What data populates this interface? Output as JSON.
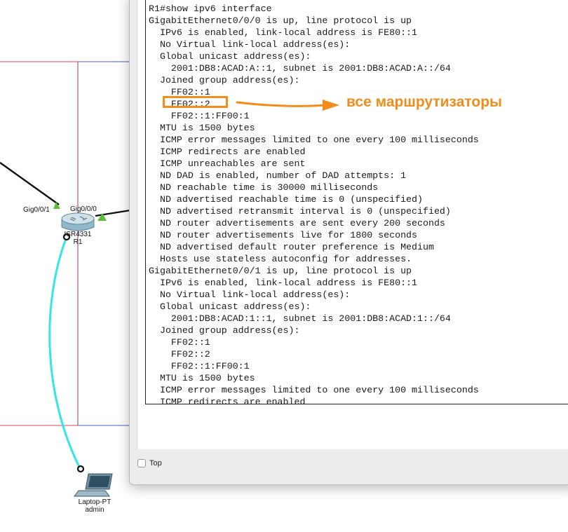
{
  "topology": {
    "interface_left_label": "Gig0/0/1",
    "interface_right_label": "Gig0/0/0",
    "router_model": "ISR4331",
    "router_name": "R1",
    "laptop_model": "Laptop-PT",
    "laptop_name": "admin",
    "icons": [
      "router-icon",
      "laptop-icon"
    ],
    "colors": {
      "console_cable": "#35e6e6",
      "link": "#111111",
      "area_red": "#d9465a",
      "area_blue": "#3b63c4",
      "area_purple": "#8c3a78",
      "link_up": "#5cbf3a"
    }
  },
  "cli": {
    "lines": [
      "R1#show ipv6 interface",
      "GigabitEthernet0/0/0 is up, line protocol is up",
      "  IPv6 is enabled, link-local address is FE80::1",
      "  No Virtual link-local address(es):",
      "  Global unicast address(es):",
      "    2001:DB8:ACAD:A::1, subnet is 2001:DB8:ACAD:A::/64",
      "  Joined group address(es):",
      "    FF02::1",
      "    FF02::2",
      "    FF02::1:FF00:1",
      "  MTU is 1500 bytes",
      "  ICMP error messages limited to one every 100 milliseconds",
      "  ICMP redirects are enabled",
      "  ICMP unreachables are sent",
      "  ND DAD is enabled, number of DAD attempts: 1",
      "  ND reachable time is 30000 milliseconds",
      "  ND advertised reachable time is 0 (unspecified)",
      "  ND advertised retransmit interval is 0 (unspecified)",
      "  ND router advertisements are sent every 200 seconds",
      "  ND router advertisements live for 1800 seconds",
      "  ND advertised default router preference is Medium",
      "  Hosts use stateless autoconfig for addresses.",
      "GigabitEthernet0/0/1 is up, line protocol is up",
      "  IPv6 is enabled, link-local address is FE80::1",
      "  No Virtual link-local address(es):",
      "  Global unicast address(es):",
      "    2001:DB8:ACAD:1::1, subnet is 2001:DB8:ACAD:1::/64",
      "  Joined group address(es):",
      "    FF02::1",
      "    FF02::2",
      "    FF02::1:FF00:1",
      "  MTU is 1500 bytes",
      "  ICMP error messages limited to one every 100 milliseconds",
      "  ICMP redirects are enabled"
    ],
    "annotation": "все маршрутизаторы",
    "annotation_color": "#f28c1a"
  },
  "window_bottom": {
    "top_checkbox_label": "Top",
    "top_checkbox_checked": false
  }
}
